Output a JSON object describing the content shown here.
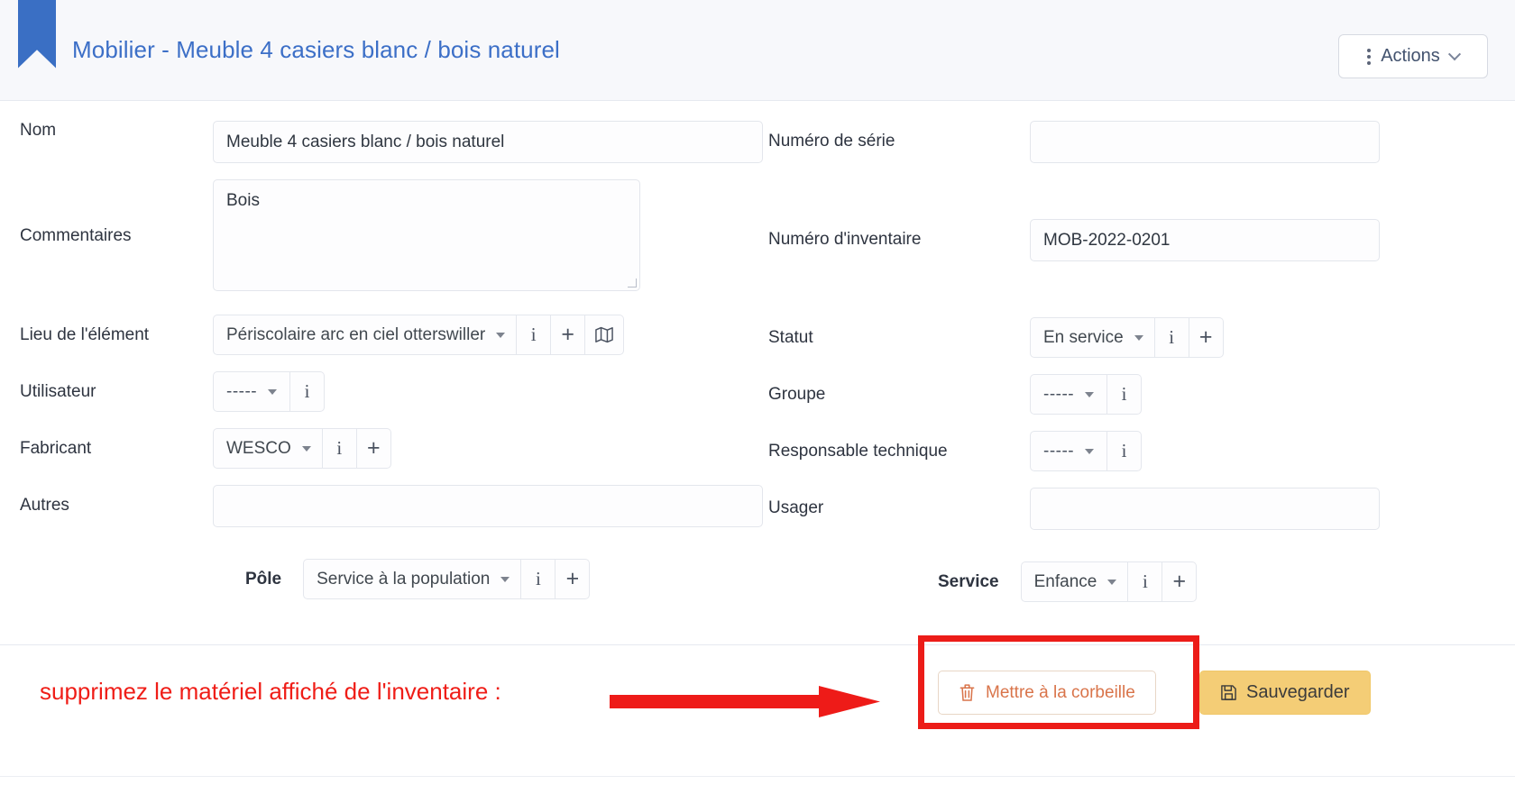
{
  "header": {
    "icon": "bookmark-ribbon-icon",
    "title": "Mobilier - Meuble 4 casiers blanc / bois naturel",
    "actions_label": "Actions",
    "kebab_icon": "vertical-dots-icon",
    "chevron_icon": "chevron-down-icon",
    "accent_color": "#3c6fc7"
  },
  "form": {
    "nom": {
      "label": "Nom",
      "value": "Meuble 4 casiers blanc / bois naturel"
    },
    "commentaires": {
      "label": "Commentaires",
      "value": "Bois"
    },
    "numero_serie": {
      "label": "Numéro de série",
      "value": ""
    },
    "numero_inventaire": {
      "label": "Numéro d'inventaire",
      "value": "MOB-2022-0201"
    },
    "lieu": {
      "label": "Lieu de l'élément",
      "value": "Périscolaire arc en ciel otterswiller",
      "info_icon": "info-icon",
      "add_icon": "plus-icon",
      "map_icon": "map-icon"
    },
    "statut": {
      "label": "Statut",
      "value": "En service",
      "info_icon": "info-icon",
      "add_icon": "plus-icon"
    },
    "utilisateur": {
      "label": "Utilisateur",
      "value": "-----",
      "info_icon": "info-icon"
    },
    "groupe": {
      "label": "Groupe",
      "value": "-----",
      "info_icon": "info-icon"
    },
    "fabricant": {
      "label": "Fabricant",
      "value": "WESCO",
      "info_icon": "info-icon",
      "add_icon": "plus-icon"
    },
    "responsable": {
      "label": "Responsable technique",
      "value": "-----",
      "info_icon": "info-icon"
    },
    "autres": {
      "label": "Autres",
      "value": ""
    },
    "usager": {
      "label": "Usager",
      "value": ""
    },
    "pole": {
      "label": "Pôle",
      "value": "Service à la population",
      "info_icon": "info-icon",
      "add_icon": "plus-icon"
    },
    "service": {
      "label": "Service",
      "value": "Enfance",
      "info_icon": "info-icon",
      "add_icon": "plus-icon"
    }
  },
  "footer": {
    "annotation": "supprimez le matériel affiché de l'inventaire :",
    "annotation_color": "#ef1d17",
    "arrow_icon": "red-arrow-right-icon",
    "highlight_color": "#ec1c18",
    "trash_button": {
      "label": "Mettre à la corbeille",
      "icon": "trash-icon",
      "color": "#d9744a"
    },
    "save_button": {
      "label": "Sauvegarder",
      "icon": "save-floppy-icon",
      "background": "#f4cd76"
    }
  }
}
